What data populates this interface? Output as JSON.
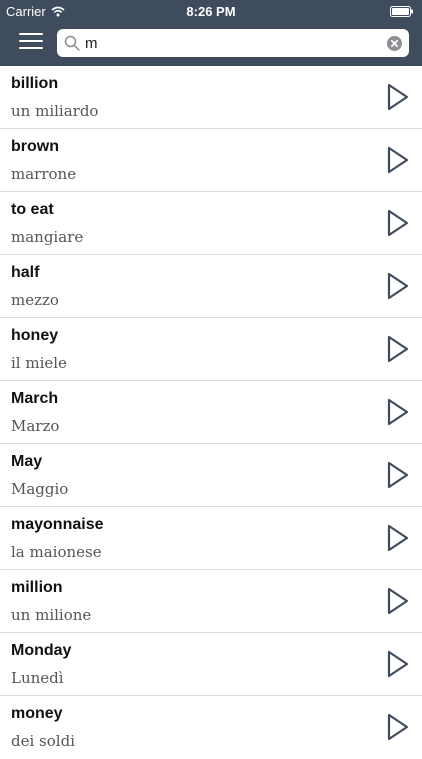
{
  "status_bar": {
    "carrier": "Carrier",
    "time": "8:26 PM"
  },
  "search": {
    "value": "m"
  },
  "colors": {
    "header": "#3f4c5e",
    "accent_icon": "#3f4c5e",
    "divider": "#dddddd"
  },
  "icons": {
    "menu": "hamburger-icon",
    "search": "search-icon",
    "clear": "clear-icon",
    "play": "play-icon",
    "wifi": "wifi-icon",
    "battery": "battery-icon"
  },
  "words": [
    {
      "english": "billion",
      "italian": "un miliardo"
    },
    {
      "english": "brown",
      "italian": "marrone"
    },
    {
      "english": "to eat",
      "italian": "mangiare"
    },
    {
      "english": "half",
      "italian": "mezzo"
    },
    {
      "english": "honey",
      "italian": "il miele"
    },
    {
      "english": "March",
      "italian": "Marzo"
    },
    {
      "english": "May",
      "italian": "Maggio"
    },
    {
      "english": "mayonnaise",
      "italian": "la maionese"
    },
    {
      "english": "million",
      "italian": "un milione"
    },
    {
      "english": "Monday",
      "italian": "Lunedì"
    },
    {
      "english": "money",
      "italian": "dei soldi"
    }
  ]
}
